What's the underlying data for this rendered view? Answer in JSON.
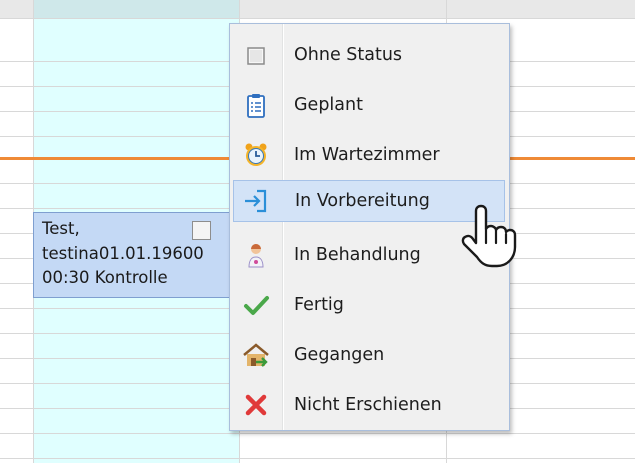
{
  "appointment": {
    "text": "Test,\ntestina01.01.19600\n00:30 Kontrolle"
  },
  "context_menu": {
    "items": [
      {
        "label": "Ohne Status",
        "icon": "empty-checkbox-icon"
      },
      {
        "label": "Geplant",
        "icon": "clipboard-icon"
      },
      {
        "label": "Im Wartezimmer",
        "icon": "alarm-clock-icon"
      },
      {
        "label": "In Vorbereitung",
        "icon": "sign-in-arrow-icon",
        "hovered": true
      },
      {
        "label": "In Behandlung",
        "icon": "doctor-icon"
      },
      {
        "label": "Fertig",
        "icon": "green-check-icon"
      },
      {
        "label": "Gegangen",
        "icon": "house-exit-icon"
      },
      {
        "label": "Nicht Erschienen",
        "icon": "red-x-icon"
      }
    ]
  },
  "colors": {
    "now_line": "#ef8a36",
    "column_highlight": "#e0ffff",
    "appointment_bg": "#c4d9f5",
    "menu_hover": "#d3e3f7"
  }
}
